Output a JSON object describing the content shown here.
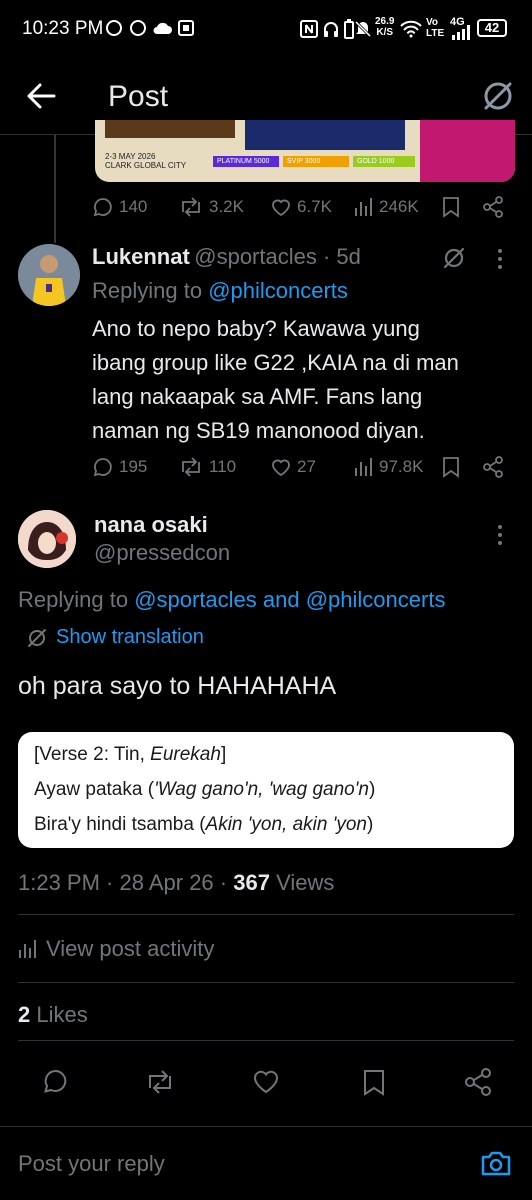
{
  "status_bar": {
    "time": "10:23 PM",
    "net_speed_top": "26.9",
    "net_speed_bottom": "K/S",
    "network": "4G",
    "battery": "42"
  },
  "header": {
    "title": "Post"
  },
  "banner": {
    "date": "2-3 MAY 2026",
    "venue": "CLARK GLOBAL CITY",
    "tiers": [
      "PLATINUM 5000",
      "SVIP 3000",
      "GOLD 1000"
    ]
  },
  "parent_stats": {
    "replies": "140",
    "reposts": "3.2K",
    "likes": "6.7K",
    "views": "246K"
  },
  "reply1": {
    "name": "Lukennat",
    "handle": "@sportacles · 5d",
    "replying_prefix": "Replying to ",
    "replying_to": "@philconcerts",
    "text_lines": [
      "Ano to nepo baby? Kawawa yung",
      "ibang group like G22 ,KAIA  na di man",
      "lang nakaapak sa AMF. Fans lang",
      "naman ng SB19 manonood diyan."
    ],
    "stats": {
      "replies": "195",
      "reposts": "110",
      "likes": "27",
      "views": "97.8K"
    }
  },
  "main": {
    "name": "nana osaki",
    "handle": "@pressedcon",
    "replying_prefix": "Replying to ",
    "replying_to": "@sportacles and @philconcerts",
    "show_translation": "Show translation",
    "text": "oh para sayo to HAHAHAHA",
    "lyrics": {
      "line1_a": "[Verse 2: Tin, ",
      "line1_b": "Eurekah",
      "line1_c": "]",
      "line2_a": "Ayaw pataka (",
      "line2_b": "'Wag gano'n, 'wag gano'n",
      "line2_c": ")",
      "line3_a": "Bira'y hindi tsamba (",
      "line3_b": "Akin 'yon, akin 'yon",
      "line3_c": ")"
    },
    "timestamp": "1:23 PM · 28 Apr 26 · ",
    "views_count": "367",
    "views_label": " Views",
    "activity_label": "View post activity",
    "likes_count": "2",
    "likes_label": " Likes"
  },
  "reply_box": {
    "placeholder": "Post your reply"
  },
  "colors": {
    "background": "#000000",
    "accent": "#1d9bf0",
    "muted": "#71767b",
    "text": "#e7e9ea",
    "divider": "#2f3336"
  }
}
